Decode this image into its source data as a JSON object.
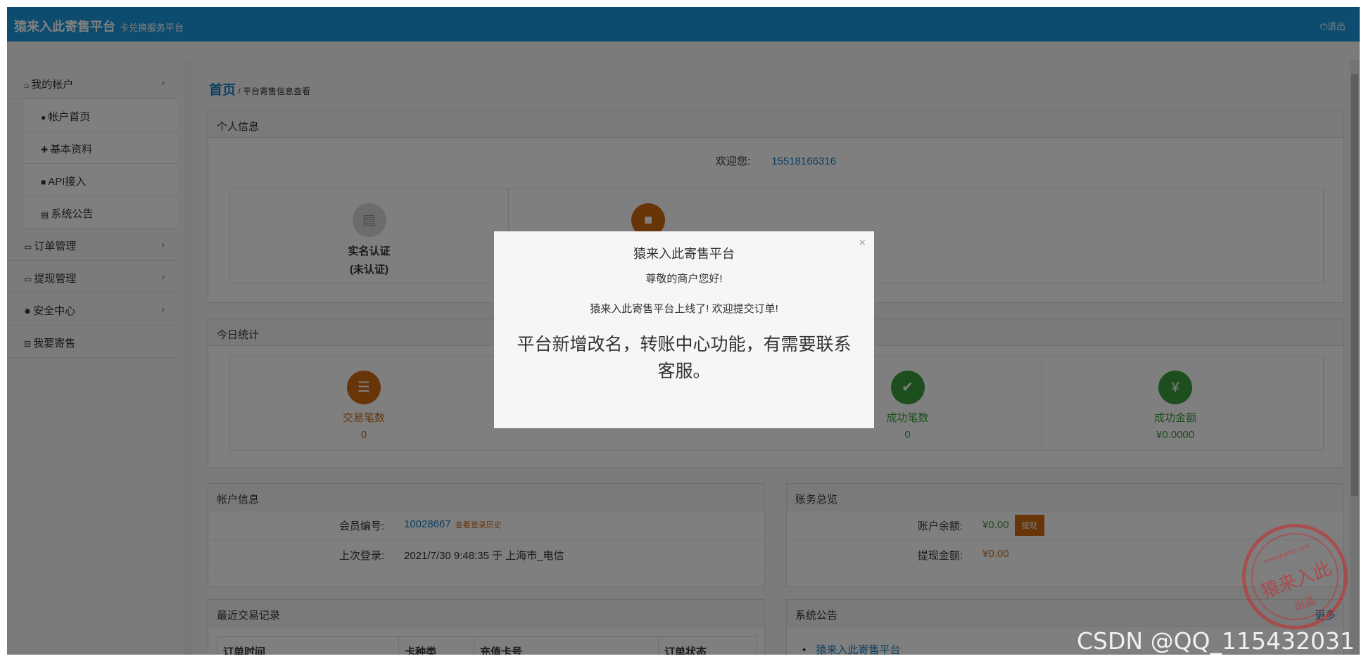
{
  "header": {
    "brand": "猿来入此寄售平台",
    "subtitle": "卡兑换服务平台",
    "logout": "退出"
  },
  "sidebar": {
    "items": [
      {
        "label": "我的帐户"
      },
      {
        "label": "帐户首页"
      },
      {
        "label": "基本资料"
      },
      {
        "label": "API接入"
      },
      {
        "label": "系统公告"
      },
      {
        "label": "订单管理"
      },
      {
        "label": "提现管理"
      },
      {
        "label": "安全中心"
      },
      {
        "label": "我要寄售"
      }
    ]
  },
  "breadcrumb": {
    "home": "首页",
    "separator": "/",
    "current": "平台寄售信息查看"
  },
  "personal": {
    "title": "个人信息",
    "welcome_label": "欢迎您:",
    "phone": "15518166316",
    "verify_label_1": "实名认证",
    "verify_label_2": "(未认证)"
  },
  "today": {
    "title": "今日统计",
    "stats": [
      {
        "label": "交易笔数",
        "value": "0",
        "color": "#d06a13"
      },
      {
        "label": "成功笔数",
        "value": "0",
        "color": "#3a9d3a"
      },
      {
        "label": "成功金额",
        "value": "¥0.0000",
        "color": "#3a9d3a"
      }
    ]
  },
  "account": {
    "title": "帐户信息",
    "member_label": "会员编号:",
    "member_id": "10028667",
    "history_link": "查看登录历史",
    "last_login_label": "上次登录:",
    "last_login": "2021/7/30 9:48:35 于 上海市_电信"
  },
  "finance": {
    "title": "账务总览",
    "balance_label": "账户余额:",
    "balance": "¥0.00",
    "withdraw_btn": "提现",
    "withdrawn_label": "提现金额:",
    "withdrawn": "¥0.00"
  },
  "recent": {
    "title": "最近交易记录",
    "columns": [
      "订单时间",
      "卡种类",
      "充值卡号",
      "订单状态"
    ]
  },
  "notice": {
    "title": "系统公告",
    "more": "更多",
    "first_item": "猿来入此寄售平台"
  },
  "modal": {
    "close": "×",
    "title": "猿来入此寄售平台",
    "greet": "尊敬的商户您好!",
    "line": "猿来入此寄售平台上线了! 欢迎提交订单!",
    "big": "平台新增改名，转账中心功能，有需要联系客服。"
  },
  "stamp": {
    "url": "www.yuanrc.com",
    "main": "猿来入此",
    "sub": "出品"
  },
  "watermark": "CSDN @QQ_115432031"
}
